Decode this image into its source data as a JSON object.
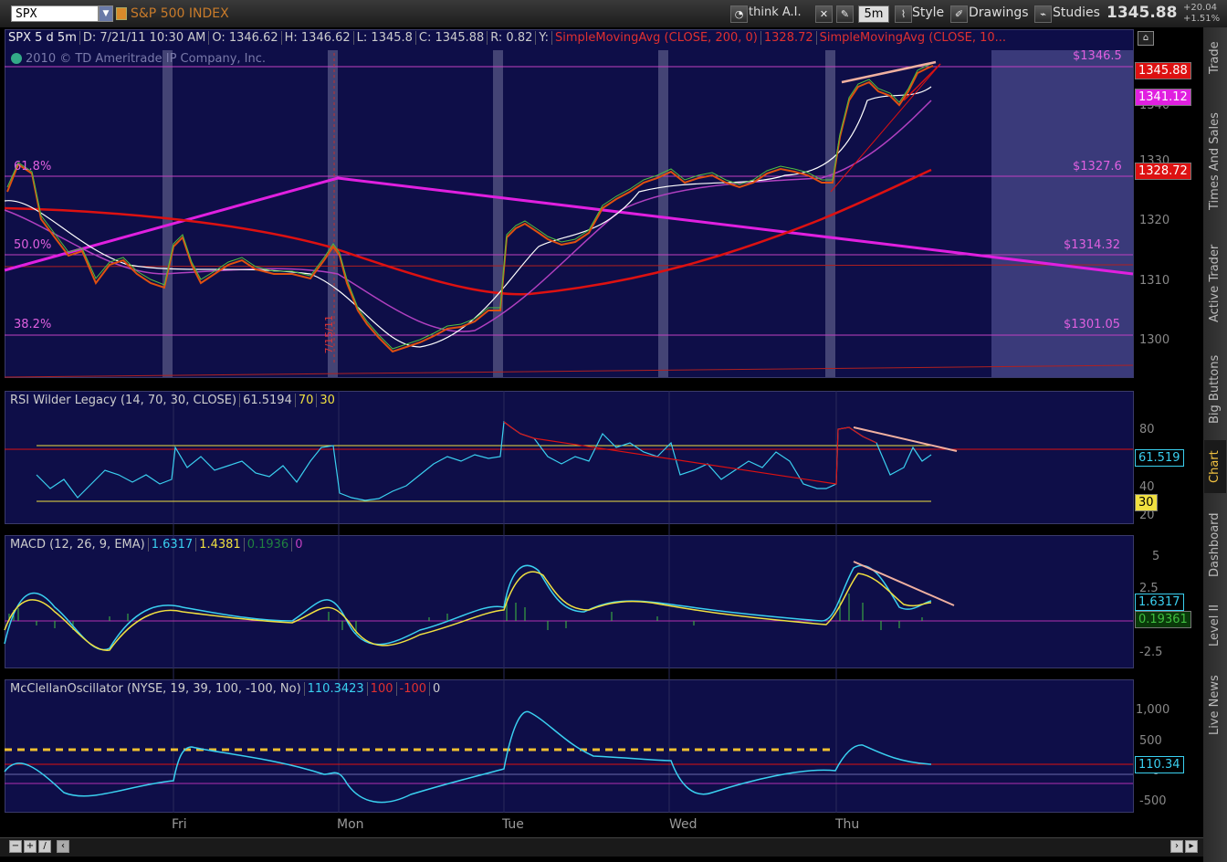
{
  "toolbar": {
    "symbol": "SPX",
    "index_name": "S&P 500 INDEX",
    "think_label": "think A.I.",
    "period": "5m",
    "style_label": "Style",
    "drawings_label": "Drawings",
    "studies_label": "Studies",
    "last_price": "1345.88",
    "change_abs": "+20.04",
    "change_pct": "+1.51%"
  },
  "price_pane": {
    "header": {
      "title": "SPX 5 d 5m",
      "date": "D: 7/21/11 10:30 AM",
      "open": "O: 1346.62",
      "high": "H: 1346.62",
      "low": "L: 1345.8",
      "close": "C: 1345.88",
      "range": "R: 0.82",
      "y": "Y:",
      "sma200": "SimpleMovingAvg (CLOSE, 200, 0)",
      "sma200_value": "1328.72",
      "sma_other": "SimpleMovingAvg (CLOSE, 10..."
    },
    "copyright": "2010 © TD Ameritrade IP Company, Inc.",
    "fib_labels": [
      "61.8%",
      "50.0%",
      "38.2%"
    ],
    "fib_prices": [
      "$1346.5",
      "$1327.6",
      "$1314.32",
      "$1301.05"
    ],
    "y_ticks": [
      "1340",
      "1330",
      "1320",
      "1310",
      "1300"
    ],
    "tags": {
      "price": "1345.88",
      "sma_magenta": "1341.12",
      "sma_red": "1328.72"
    },
    "vertical_date_text": "7/15/11"
  },
  "rsi_pane": {
    "header": {
      "name": "RSI Wilder Legacy (14, 70, 30, CLOSE)",
      "value": "61.5194",
      "ob": "70",
      "os": "30"
    },
    "y_ticks": [
      "80",
      "60",
      "40",
      "20"
    ],
    "tags": {
      "value": "61.519",
      "os": "30"
    }
  },
  "macd_pane": {
    "header": {
      "name": "MACD (12, 26, 9, EMA)",
      "value": "1.6317",
      "avg": "1.4381",
      "diff": "0.1936",
      "zero": "0"
    },
    "y_ticks": [
      "5",
      "2.5",
      "0",
      "-2.5"
    ],
    "tags": {
      "value": "1.6317",
      "diff": "0.19361"
    }
  },
  "mcc_pane": {
    "header": {
      "name": "McClellanOscillator (NYSE, 19, 39, 100, -100, No)",
      "value": "110.3423",
      "ob": "100",
      "os": "-100",
      "zero": "0"
    },
    "y_ticks": [
      "1,000",
      "500",
      "0",
      "-500"
    ],
    "tags": {
      "value": "110.34"
    }
  },
  "days": [
    "Fri",
    "Mon",
    "Tue",
    "Wed",
    "Thu"
  ],
  "side_tabs": [
    "Trade",
    "Times And Sales",
    "Active Trader",
    "Big Buttons",
    "Chart",
    "Dashboard",
    "Level II",
    "Live News"
  ],
  "colors": {
    "pane_bg": "#0e0e48",
    "price_tag": "#d11",
    "magenta": "#e020e0",
    "rsi": "#3ad0f0",
    "yellow": "#f0e040"
  }
}
